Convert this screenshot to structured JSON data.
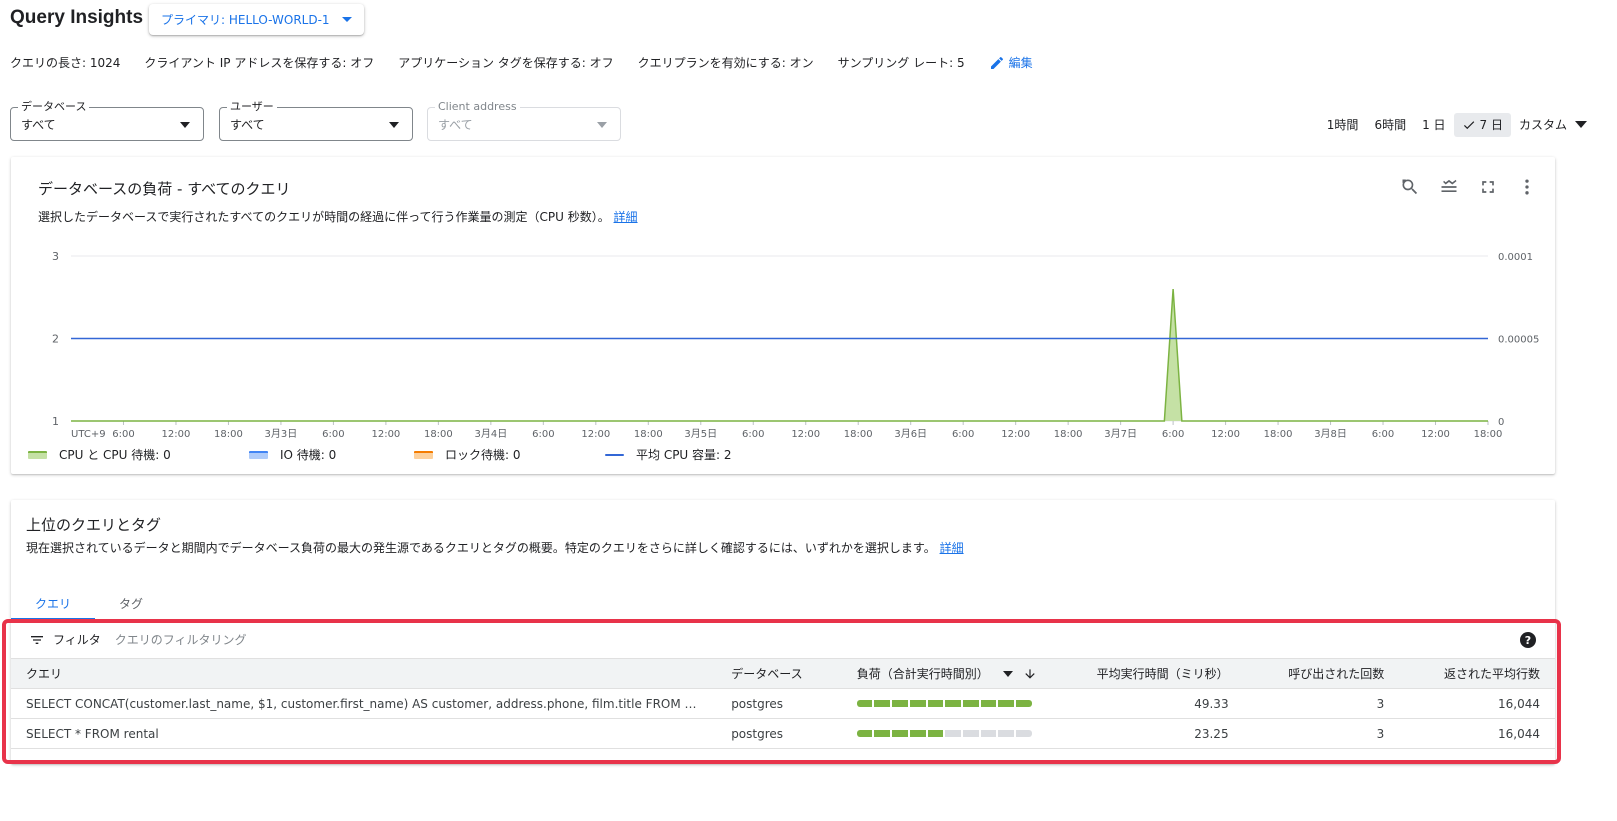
{
  "header": {
    "title": "Query Insights",
    "instance_label": "プライマリ: HELLO-WORLD-1"
  },
  "settings": {
    "items": [
      {
        "label": "クエリの長さ: ",
        "value": "1024"
      },
      {
        "label": "クライアント IP アドレスを保存する: ",
        "value": "オフ"
      },
      {
        "label": "アプリケーション タグを保存する: ",
        "value": "オフ"
      },
      {
        "label": "クエリプランを有効にする: ",
        "value": "オン"
      },
      {
        "label": "サンプリング レート: ",
        "value": "5"
      }
    ],
    "edit_label": "編集"
  },
  "filters": {
    "database": {
      "label": "データベース",
      "value": "すべて"
    },
    "user": {
      "label": "ユーザー",
      "value": "すべて"
    },
    "client": {
      "label": "Client address",
      "value": "すべて"
    }
  },
  "time_range": {
    "options": [
      "1時間",
      "6時間",
      "1 日",
      "7 日"
    ],
    "selected": "7 日",
    "custom_label": "カスタム"
  },
  "load_chart": {
    "title": "データベースの負荷 - すべてのクエリ",
    "subtitle": "選択したデータベースで実行されたすべてのクエリが時間の経過に伴って行う作業量の測定（CPU 秒数）。",
    "link": "詳細",
    "legend": [
      {
        "label": "CPU と CPU 待機: 0",
        "color": "#c5e1a5",
        "border": "#7cb342",
        "type": "area"
      },
      {
        "label": "IO 待機: 0",
        "color": "#aecbfa",
        "border": "#4285f4",
        "type": "area"
      },
      {
        "label": "ロック待機: 0",
        "color": "#fdd09b",
        "border": "#f57c00",
        "type": "area"
      },
      {
        "label": "平均 CPU 容量: 2",
        "color": "#3367d6",
        "border": "#3367d6",
        "type": "line"
      }
    ]
  },
  "chart_data": {
    "type": "area",
    "title": "データベースの負荷 - すべてのクエリ",
    "xlabel": "",
    "x_tick_labels": [
      "UTC+9",
      "6:00",
      "12:00",
      "18:00",
      "3月3日",
      "6:00",
      "12:00",
      "18:00",
      "3月4日",
      "6:00",
      "12:00",
      "18:00",
      "3月5日",
      "6:00",
      "12:00",
      "18:00",
      "3月6日",
      "6:00",
      "12:00",
      "18:00",
      "3月7日",
      "6:00",
      "12:00",
      "18:00",
      "3月8日",
      "6:00",
      "12:00",
      "18:00"
    ],
    "x_range_hours": [
      0,
      162
    ],
    "ylim_left": [
      1,
      3
    ],
    "y_ticks_left": [
      "1",
      "2",
      "3"
    ],
    "ylim_right": [
      0,
      0.0001
    ],
    "y_ticks_right": [
      "0",
      "0.00005",
      "0.0001"
    ],
    "grid": true,
    "series": [
      {
        "name": "CPU と CPU 待機",
        "axis": "right",
        "points": [
          [
            0,
            0
          ],
          [
            125,
            0
          ],
          [
            126,
            8e-05
          ],
          [
            127,
            0
          ],
          [
            162,
            0
          ]
        ]
      },
      {
        "name": "平均 CPU 容量",
        "axis": "left",
        "points": [
          [
            0,
            2
          ],
          [
            162,
            2
          ]
        ]
      }
    ]
  },
  "top_queries": {
    "title": "上位のクエリとタグ",
    "subtitle": "現在選択されているデータと期間内でデータベース負荷の最大の発生源であるクエリとタグの概要。特定のクエリをさらに詳しく確認するには、いずれかを選択します。",
    "link": "詳細",
    "tabs": [
      "クエリ",
      "タグ"
    ],
    "filter_label": "フィルタ",
    "filter_placeholder": "クエリのフィルタリング",
    "columns": [
      "クエリ",
      "データベース",
      "負荷（合計実行時間別）",
      "平均実行時間（ミリ秒）",
      "呼び出された回数",
      "返された平均行数"
    ],
    "rows": [
      {
        "query": "SELECT CONCAT(customer.last_name, $1, customer.first_name) AS customer, address.phone, film.title FROM rental IN...",
        "database": "postgres",
        "load_fraction": 1.0,
        "avg_time": "49.33",
        "calls": "3",
        "avg_rows": "16,044"
      },
      {
        "query": "SELECT * FROM rental",
        "database": "postgres",
        "load_fraction": 0.47,
        "avg_time": "23.25",
        "calls": "3",
        "avg_rows": "16,044"
      }
    ]
  }
}
